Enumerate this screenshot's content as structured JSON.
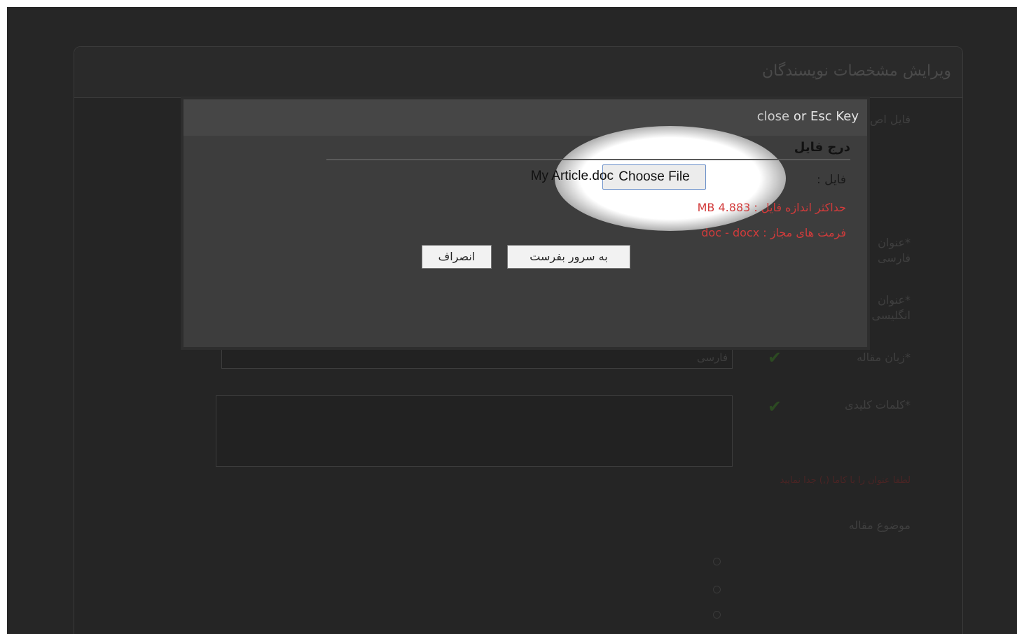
{
  "background_page": {
    "title": "ویرایش مشخصات نویسندگان",
    "rows": {
      "main_file_label": "فایل اص",
      "persian_title_label_1": "*عنوان",
      "persian_title_label_2": "فارسی",
      "english_title_label_1": "*عنوان",
      "english_title_label_2": "انگلیسی",
      "article_language_label": "*زبان مقاله",
      "article_language_value": "فارسی",
      "keywords_label": "*کلمات کلیدی",
      "keywords_hint": "لطفا عنوان را با کاما (,) جدا نمایید",
      "subject_label": "موضوع مقاله"
    }
  },
  "modal": {
    "close_text": "close",
    "close_or": "or",
    "close_key": "Esc Key",
    "section_title": "درج فایل",
    "file_label": "فایل :",
    "choose_file_label": "Choose File",
    "selected_file_name": "My Article.doc",
    "max_size_text": "حداکثر اندازه فایل : 4.883 MB",
    "allowed_formats_text": "فرمت های مجاز : doc - docx",
    "submit_label": "به سرور بفرست",
    "cancel_label": "انصراف"
  },
  "colors": {
    "overlay": "#262626",
    "modal_body": "#3d3d3d",
    "info_red": "#d23b3b",
    "choose_border": "#6a8fc8"
  }
}
